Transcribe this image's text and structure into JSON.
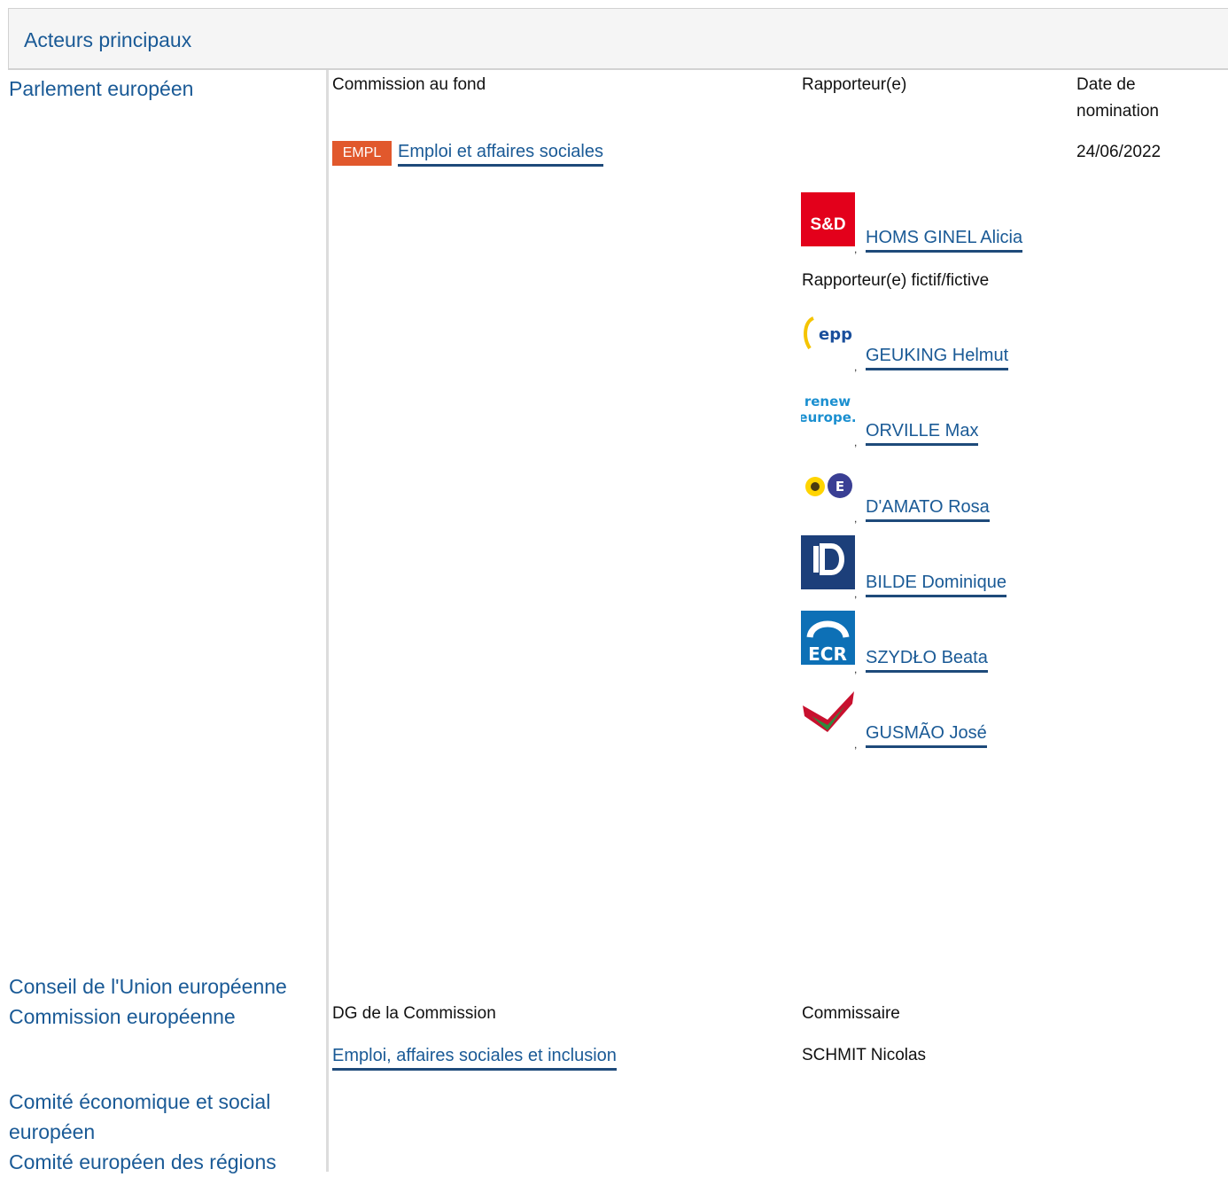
{
  "section": {
    "title": "Acteurs principaux"
  },
  "actors": [
    "Parlement européen",
    "Conseil de l'Union européenne",
    "Commission européenne",
    "Comité économique et social européen",
    "Comité européen des régions"
  ],
  "parliament": {
    "col_committee": "Commission au fond",
    "col_rapporteur": "Rapporteur(e)",
    "col_date_line1": "Date de",
    "col_date_line2": "nomination",
    "committee_badge": "EMPL",
    "committee_name": "Emploi et affaires sociales",
    "date": "24/06/2022",
    "rapporteur": {
      "name": "HOMS GINEL Alicia",
      "group_logo": "S&D",
      "comma": ","
    },
    "shadow_label": "Rapporteur(e) fictif/fictive",
    "shadows": [
      {
        "name": "GEUKING Helmut",
        "group_icon": "epp-logo-icon",
        "comma": ","
      },
      {
        "name": "ORVILLE Max",
        "group_icon": "renew-europe-logo-icon",
        "comma": ","
      },
      {
        "name": "D'AMATO Rosa",
        "group_icon": "greens-efa-logo-icon",
        "comma": ","
      },
      {
        "name": "BILDE Dominique",
        "group_icon": "id-logo-icon",
        "comma": ","
      },
      {
        "name": "SZYDŁO Beata",
        "group_icon": "ecr-logo-icon",
        "comma": ","
      },
      {
        "name": "GUSMÃO José",
        "group_icon": "gue-ngl-logo-icon",
        "comma": ","
      }
    ]
  },
  "commission": {
    "col_dg": "DG de la Commission",
    "col_commissioner": "Commissaire",
    "dg_name": "Emploi, affaires sociales et inclusion",
    "commissioner": "SCHMIT Nicolas"
  },
  "colors": {
    "link": "#1a5a96",
    "badge": "#e1582c",
    "underline": "#1e4a7a"
  }
}
